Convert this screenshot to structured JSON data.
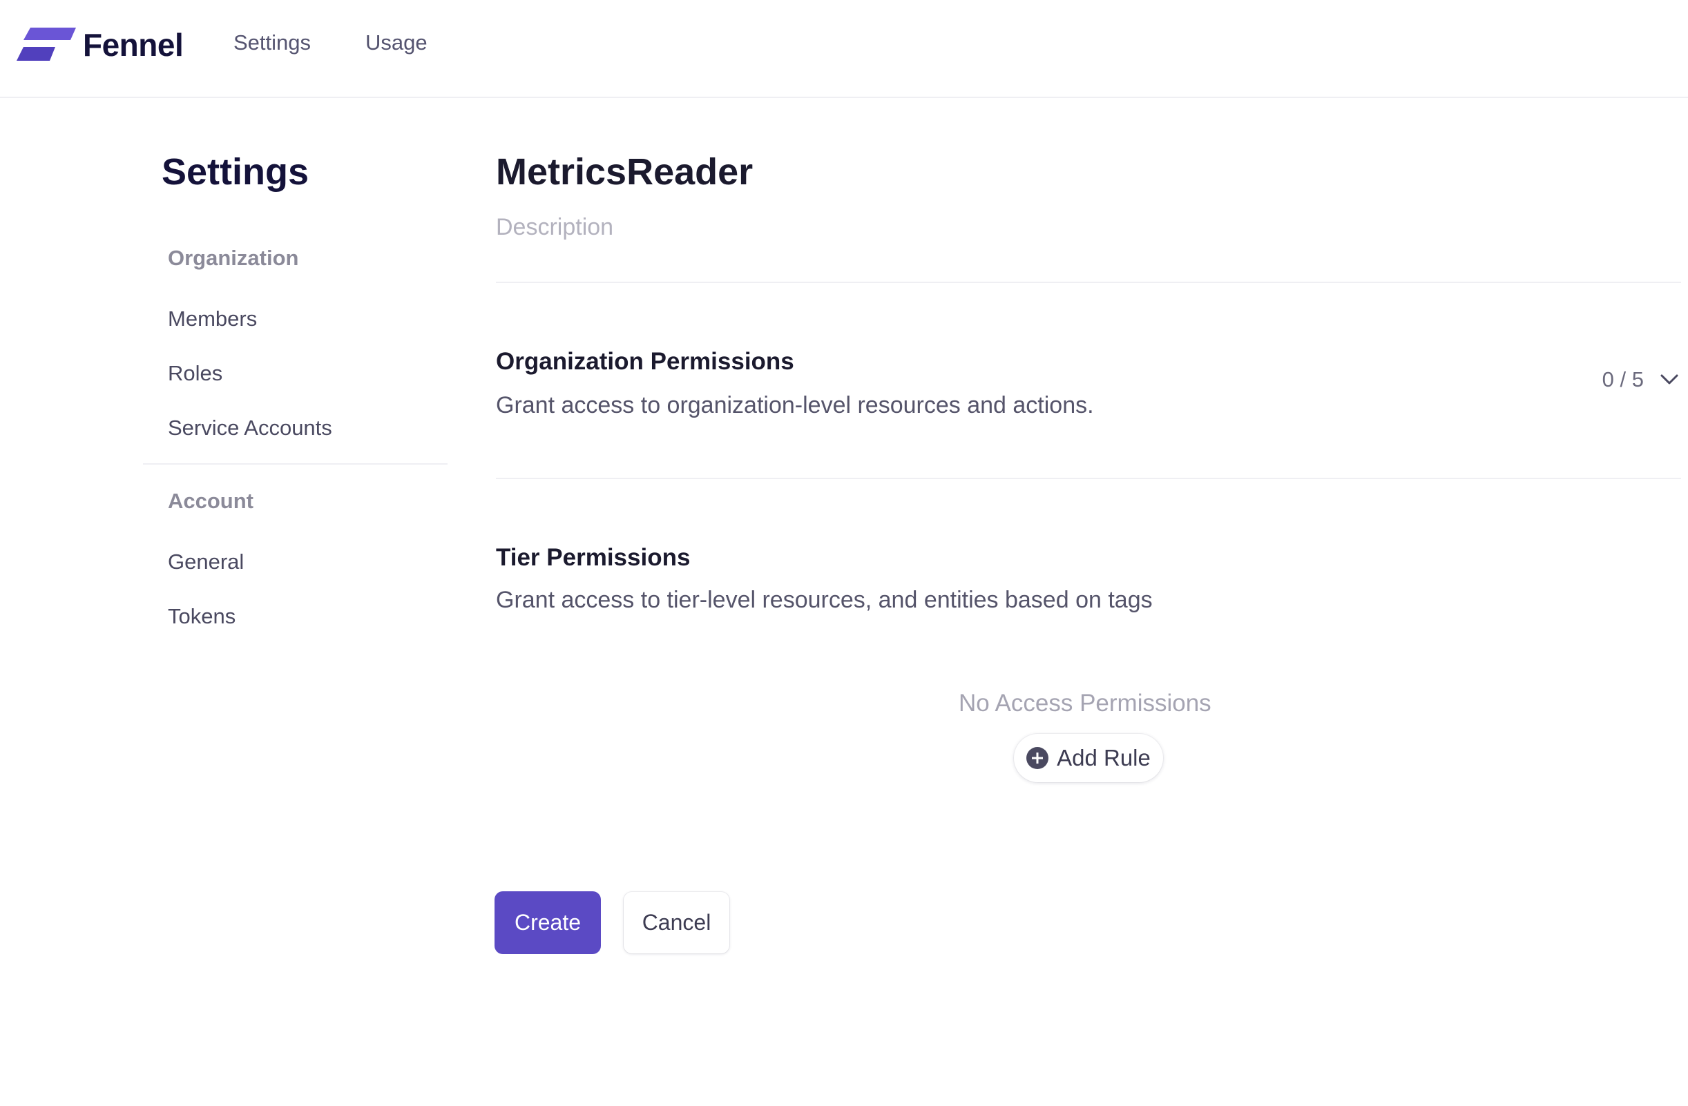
{
  "app": {
    "brand": "Fennel",
    "logo_icon": "fennel-logo-icon",
    "accent_color": "#5b4ac4"
  },
  "topnav": {
    "items": [
      {
        "label": "Settings"
      },
      {
        "label": "Usage"
      }
    ]
  },
  "sidebar": {
    "title": "Settings",
    "groups": [
      {
        "label": "Organization",
        "items": [
          {
            "label": "Members"
          },
          {
            "label": "Roles"
          },
          {
            "label": "Service Accounts"
          }
        ]
      },
      {
        "label": "Account",
        "items": [
          {
            "label": "General"
          },
          {
            "label": "Tokens"
          }
        ]
      }
    ]
  },
  "main": {
    "role_name": "MetricsReader",
    "description": {
      "value": "",
      "placeholder": "Description"
    },
    "org_permissions": {
      "heading": "Organization Permissions",
      "subtitle": "Grant access to organization-level resources and actions.",
      "count": "0 / 5",
      "toggle_icon": "chevron-down-icon"
    },
    "tier_permissions": {
      "heading": "Tier Permissions",
      "subtitle": "Grant access to tier-level resources, and entities based on tags",
      "empty_text": "No Access Permissions",
      "add_rule_label": "Add Rule",
      "add_rule_icon": "plus-circle-icon"
    },
    "actions": {
      "create_label": "Create",
      "cancel_label": "Cancel"
    }
  }
}
